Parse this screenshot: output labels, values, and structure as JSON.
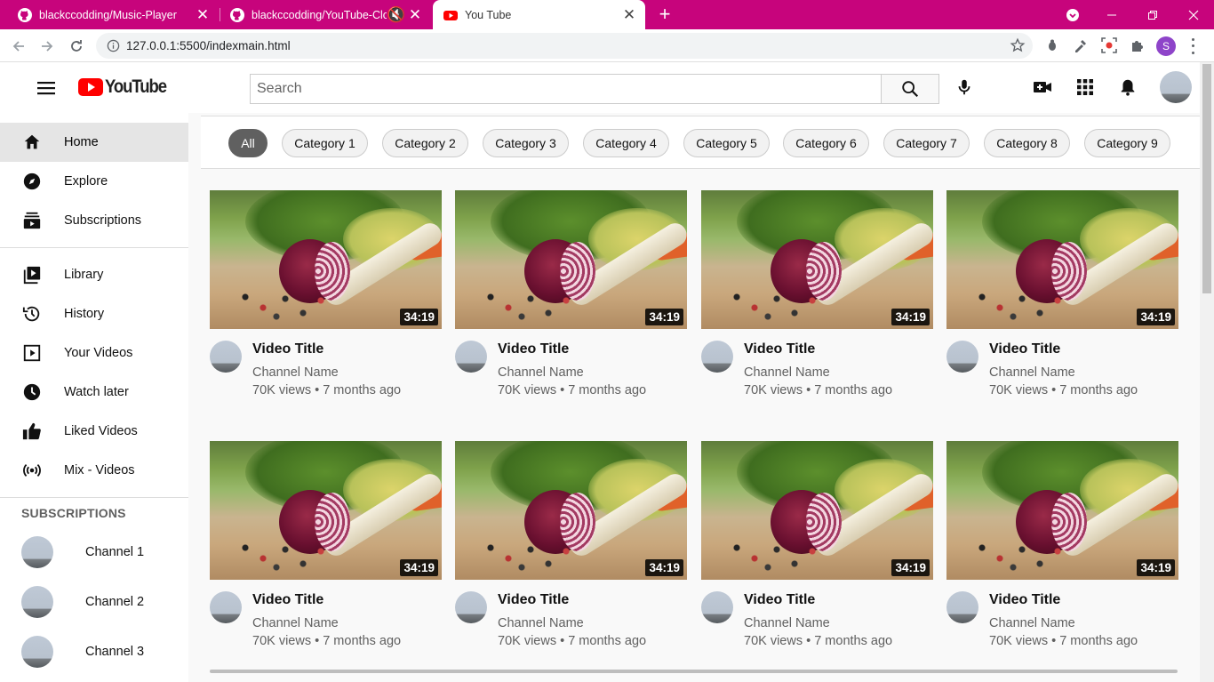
{
  "browser": {
    "tabs": [
      {
        "title": "blackccodding/Music-Player",
        "active": false
      },
      {
        "title": "blackccodding/YouTube-Clone:",
        "active": false
      },
      {
        "title": "You Tube",
        "active": true
      }
    ],
    "url": "127.0.0.1:5500/indexmain.html",
    "profile_initial": "S",
    "chrome_color": "#c7047c"
  },
  "header": {
    "logo_text": "YouTube",
    "search_placeholder": "Search"
  },
  "sidebar": {
    "main": [
      {
        "label": "Home",
        "icon": "home-icon",
        "active": true
      },
      {
        "label": "Explore",
        "icon": "compass-icon"
      },
      {
        "label": "Subscriptions",
        "icon": "subscriptions-icon"
      }
    ],
    "library": [
      {
        "label": "Library",
        "icon": "library-icon"
      },
      {
        "label": "History",
        "icon": "history-icon"
      },
      {
        "label": "Your Videos",
        "icon": "your-videos-icon"
      },
      {
        "label": "Watch later",
        "icon": "clock-icon"
      },
      {
        "label": "Liked Videos",
        "icon": "thumbs-up-icon"
      },
      {
        "label": "Mix - Videos",
        "icon": "broadcast-icon"
      }
    ],
    "subscriptions_heading": "SUBSCRIPTIONS",
    "subscriptions": [
      "Channel 1",
      "Channel 2",
      "Channel 3"
    ]
  },
  "chips": [
    "All",
    "Category 1",
    "Category 2",
    "Category 3",
    "Category 4",
    "Category 5",
    "Category 6",
    "Category 7",
    "Category 8",
    "Category 9"
  ],
  "videos": [
    {
      "title": "Video Title",
      "channel": "Channel Name",
      "meta": "70K views • 7 months ago",
      "duration": "34:19"
    },
    {
      "title": "Video Title",
      "channel": "Channel Name",
      "meta": "70K views • 7 months ago",
      "duration": "34:19"
    },
    {
      "title": "Video Title",
      "channel": "Channel Name",
      "meta": "70K views • 7 months ago",
      "duration": "34:19"
    },
    {
      "title": "Video Title",
      "channel": "Channel Name",
      "meta": "70K views • 7 months ago",
      "duration": "34:19"
    },
    {
      "title": "Video Title",
      "channel": "Channel Name",
      "meta": "70K views • 7 months ago",
      "duration": "34:19"
    },
    {
      "title": "Video Title",
      "channel": "Channel Name",
      "meta": "70K views • 7 months ago",
      "duration": "34:19"
    },
    {
      "title": "Video Title",
      "channel": "Channel Name",
      "meta": "70K views • 7 months ago",
      "duration": "34:19"
    },
    {
      "title": "Video Title",
      "channel": "Channel Name",
      "meta": "70K views • 7 months ago",
      "duration": "34:19"
    }
  ]
}
